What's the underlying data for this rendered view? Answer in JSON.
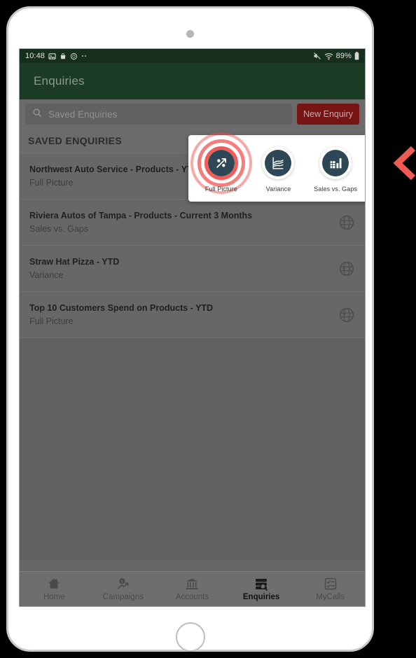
{
  "status_bar": {
    "time": "10:48",
    "left_icons": [
      "image-icon",
      "bag-icon",
      "clock-icon",
      "more-dots-icon"
    ],
    "right_icons": [
      "mute-icon",
      "wifi-icon"
    ],
    "battery_percent": "89%",
    "battery_icon": "battery-icon"
  },
  "header": {
    "title": "Enquiries"
  },
  "search": {
    "icon": "search-icon",
    "placeholder": "Saved Enquiries",
    "value": ""
  },
  "toolbar": {
    "new_enquiry_label": "New Enquiry"
  },
  "section": {
    "title": "SAVED ENQUIRIES"
  },
  "enquiries": [
    {
      "title": "Northwest Auto Service - Products - YTD",
      "subtitle": "Full Picture",
      "icon": "globe-icon"
    },
    {
      "title": "Riviera Autos of Tampa - Products - Current 3 Months",
      "subtitle": "Sales vs. Gaps",
      "icon": "globe-icon"
    },
    {
      "title": "Straw Hat Pizza - YTD",
      "subtitle": "Variance",
      "icon": "globe-icon"
    },
    {
      "title": "Top 10 Customers Spend on Products - YTD",
      "subtitle": "Full Picture",
      "icon": "globe-icon"
    }
  ],
  "popup": {
    "options": [
      {
        "label": "Full Picture",
        "icon": "percent-trend-icon",
        "selected": true
      },
      {
        "label": "Variance",
        "icon": "line-chart-icon",
        "selected": false
      },
      {
        "label": "Sales vs. Gaps",
        "icon": "bar-chart-icon",
        "selected": false
      }
    ]
  },
  "bottom_nav": {
    "items": [
      {
        "label": "Home",
        "icon": "home-icon",
        "active": false
      },
      {
        "label": "Campaigns",
        "icon": "campaigns-icon",
        "active": false
      },
      {
        "label": "Accounts",
        "icon": "bank-icon",
        "active": false
      },
      {
        "label": "Enquiries",
        "icon": "enquiries-icon",
        "active": true
      },
      {
        "label": "MyCalls",
        "icon": "checklist-icon",
        "active": false
      }
    ]
  },
  "annotation": {
    "arrow": "chevron-left-arrow"
  },
  "colors": {
    "status_bar": "#16301d",
    "header": "#1c3d25",
    "accent_red": "#7a1616",
    "ripple_red": "#ef5350",
    "icon_navy": "#2e4756",
    "screen_bg": "#6a6a6a"
  }
}
